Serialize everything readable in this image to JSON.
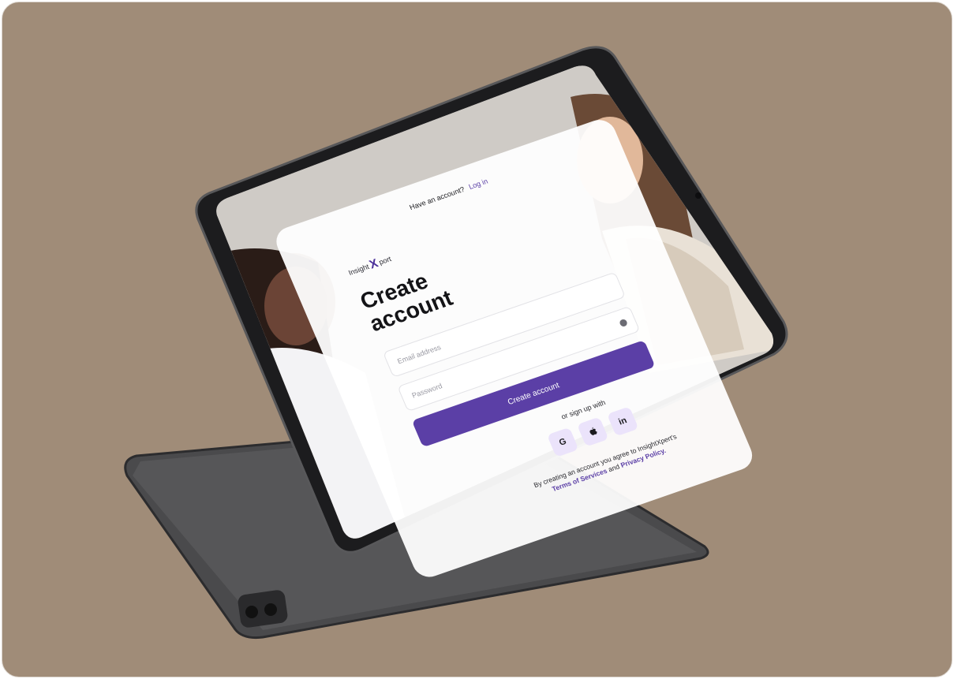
{
  "header": {
    "prompt_text": "Have an account?",
    "login_link": "Log in"
  },
  "brand": {
    "logo_left": "Insight",
    "logo_x": "X",
    "logo_right": "port"
  },
  "form": {
    "title": "Create account",
    "email_placeholder": "Email address",
    "password_placeholder": "Password",
    "submit_label": "Create account",
    "or_text": "or sign up with",
    "social": [
      {
        "label": "G",
        "icon": "google-icon"
      },
      {
        "label": "",
        "icon": "apple-icon"
      },
      {
        "label": "in",
        "icon": "linkedin-icon"
      }
    ]
  },
  "terms": {
    "lead": "By creating an account you agree to InsightXpert's",
    "terms_link": "Terms of Services",
    "and": "and",
    "privacy_link": "Privacy Policy."
  },
  "colors": {
    "accent": "#5b3fa6",
    "background": "#a08c78",
    "social_bg": "#ebe3fb"
  }
}
